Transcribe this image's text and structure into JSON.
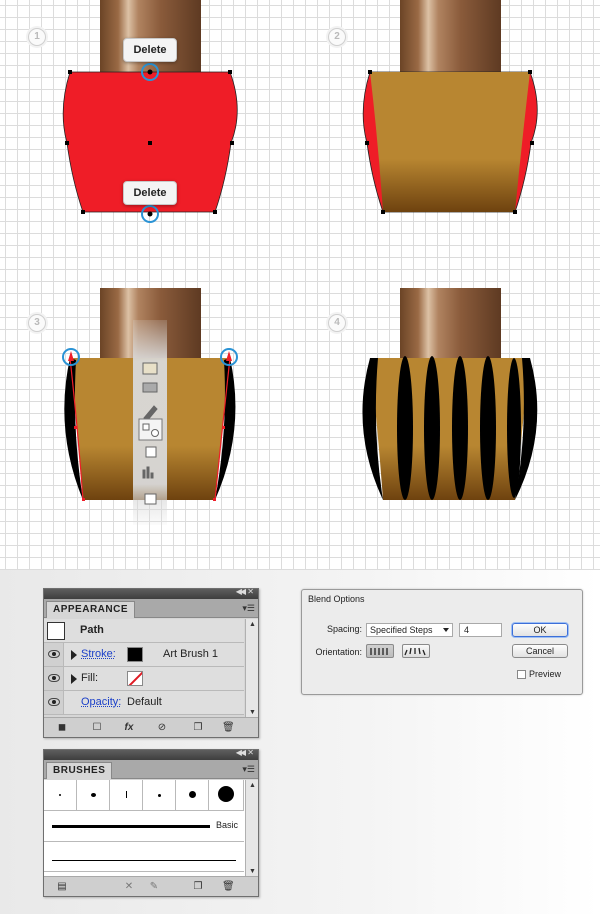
{
  "steps": [
    "1",
    "2",
    "3",
    "4"
  ],
  "tooltips": {
    "delete_top": "Delete",
    "delete_bottom": "Delete"
  },
  "colors": {
    "red": "#ef1d27",
    "gold": "#b7852f",
    "handle_dark": "#6e4a2d",
    "handle_light": "#d8b89a",
    "black": "#000000",
    "anchor_blue": "#2a93d5"
  },
  "toolbar_icons": [
    "hand-icon",
    "image-icon",
    "gradient-icon",
    "eyedropper-icon",
    "blend-icon",
    "symbol-sprayer-icon",
    "column-graph-icon",
    "artboard-icon"
  ],
  "appearance": {
    "tab": "APPEARANCE",
    "path_label": "Path",
    "stroke_label": "Stroke:",
    "stroke_value": "Art Brush 1",
    "fill_label": "Fill:",
    "opacity_label": "Opacity:",
    "opacity_value": "Default",
    "footer_icons": [
      "new-art-icon",
      "square-icon",
      "fx-icon",
      "clear-icon",
      "duplicate-icon",
      "delete-icon"
    ]
  },
  "blend": {
    "title": "Blend Options",
    "spacing_label": "Spacing:",
    "spacing_value": "Specified Steps",
    "steps_value": "4",
    "orientation_label": "Orientation:",
    "ok": "OK",
    "cancel": "Cancel",
    "preview": "Preview"
  },
  "brushes": {
    "tab": "BRUSHES",
    "basic_label": "Basic",
    "footer_icons": [
      "library-icon",
      "remove-stroke-icon",
      "options-icon",
      "new-brush-icon",
      "delete-brush-icon"
    ]
  }
}
